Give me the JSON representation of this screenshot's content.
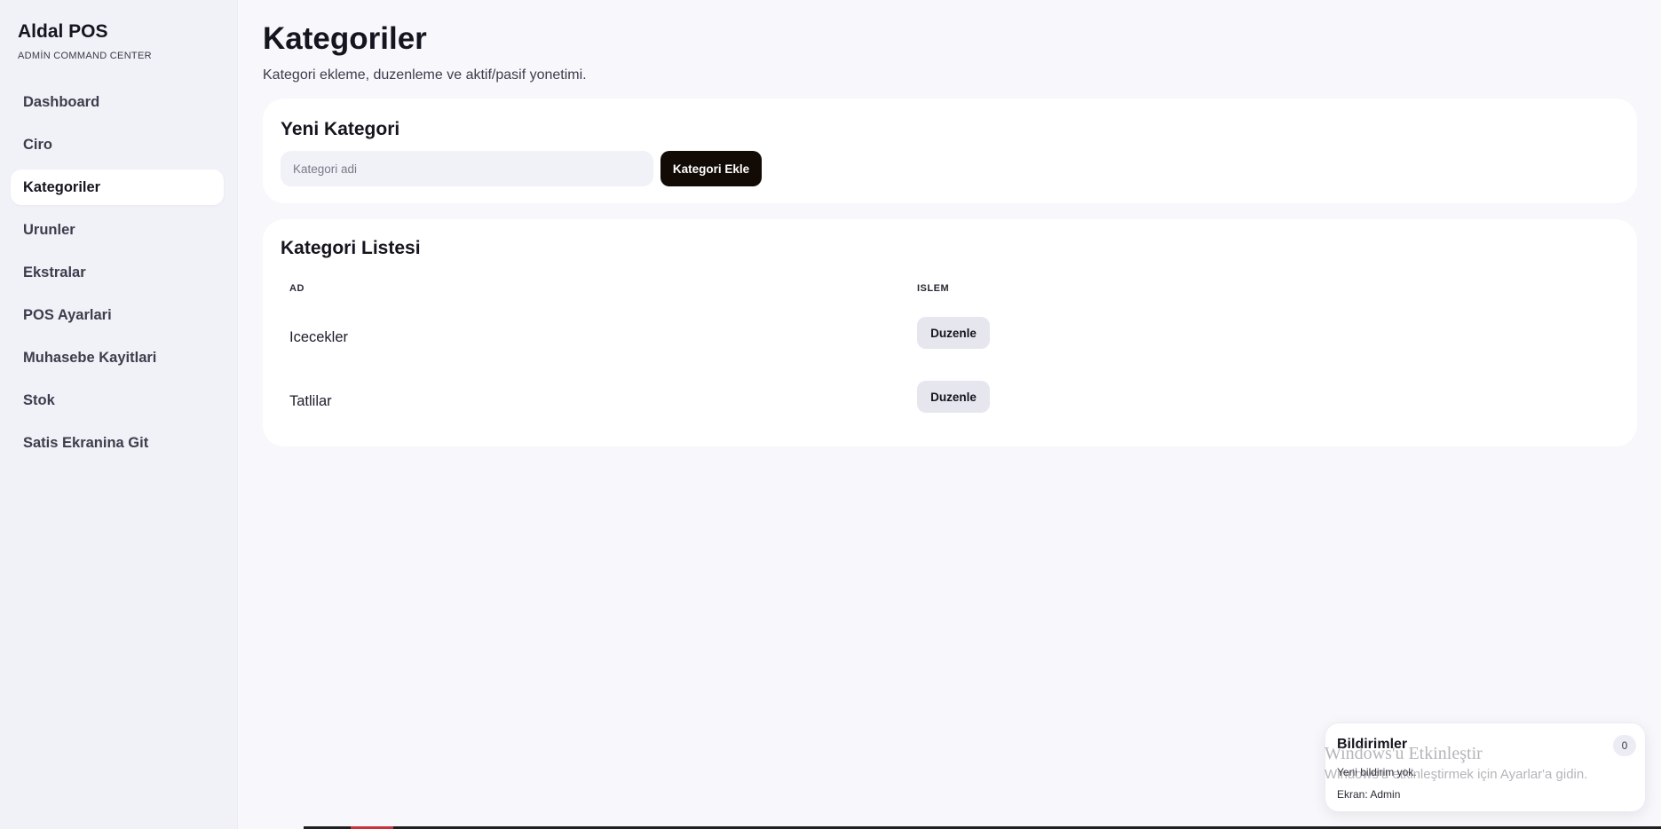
{
  "sidebar": {
    "brand_title": "Aldal POS",
    "brand_subtitle": "ADMİN COMMAND CENTER",
    "items": [
      {
        "label": "Dashboard"
      },
      {
        "label": "Ciro"
      },
      {
        "label": "Kategoriler",
        "active": true
      },
      {
        "label": "Urunler"
      },
      {
        "label": "Ekstralar"
      },
      {
        "label": "POS Ayarlari"
      },
      {
        "label": "Muhasebe Kayitlari"
      },
      {
        "label": "Stok"
      },
      {
        "label": "Satis Ekranina Git"
      }
    ]
  },
  "header": {
    "title": "Kategoriler",
    "subtitle": "Kategori ekleme, duzenleme ve aktif/pasif yonetimi."
  },
  "new_category": {
    "title": "Yeni Kategori",
    "input_value": "",
    "input_placeholder": "Kategori adi",
    "add_button": "Kategori Ekle"
  },
  "category_list": {
    "title": "Kategori Listesi",
    "columns": [
      "AD",
      "ISLEM"
    ],
    "rows": [
      {
        "name": "Icecekler",
        "action": "Duzenle"
      },
      {
        "name": "Tatlilar",
        "action": "Duzenle"
      }
    ]
  },
  "notifications": {
    "title": "Bildirimler",
    "count": "0",
    "empty_text": "Yeni bildirim yok.",
    "screen_text": "Ekran: Admin"
  },
  "watermark": {
    "title": "Windows'u Etkinleştir",
    "subtitle": "Windows'u etkinleştirmek için Ayarlar'a gidin."
  },
  "colors": {
    "background": "#f7f7fc",
    "sidebar": "#f1f1f8",
    "primary_button": "#120a04",
    "secondary_button": "#e6e6ef"
  }
}
